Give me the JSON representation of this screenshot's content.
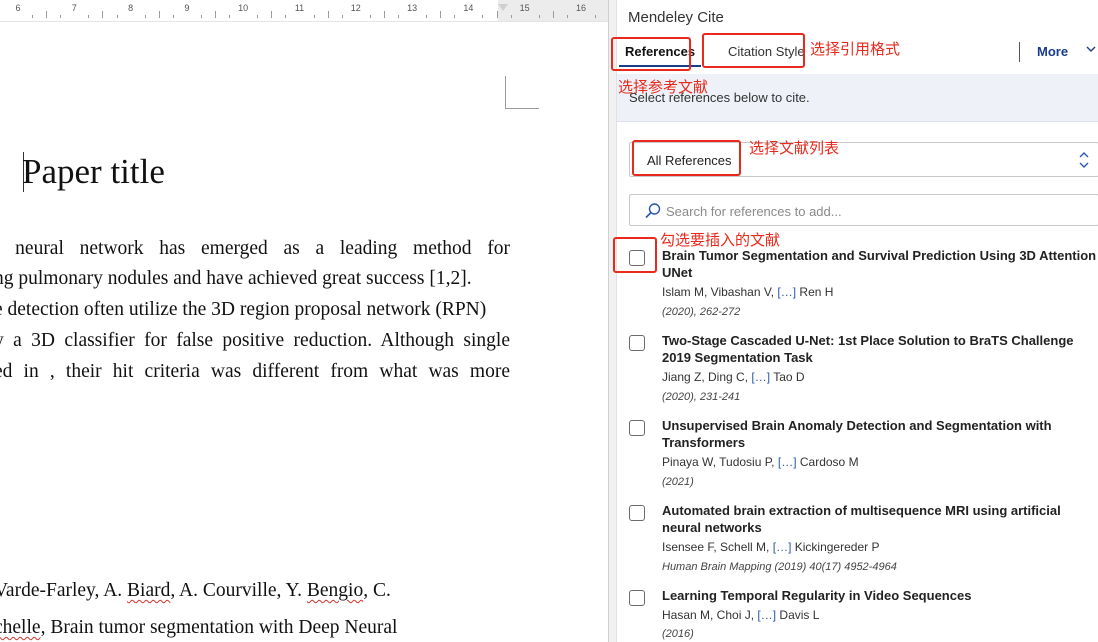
{
  "document": {
    "ruler": {
      "labels": [
        "6",
        "7",
        "8",
        "9",
        "10",
        "11",
        "12",
        "13",
        "14",
        "15",
        "16"
      ]
    },
    "title": "Paper title",
    "body_lines": [
      "l neural network has emerged as a leading method for",
      "ng pulmonary nodules and have achieved great success [1,2].",
      "e detection often utilize the 3D region proposal network (RPN)",
      "y a 3D classifier for false positive reduction. Although single",
      "ed in , their hit criteria was different from what was more"
    ],
    "reference_lines": {
      "line1": {
        "a": "Varde-Farley, A. ",
        "b": "Biard",
        "c": ", A. Courville, Y. ",
        "d": "Bengio",
        "e": ", C."
      },
      "line2": {
        "a": "chelle",
        "b": ", Brain tumor segmentation with Deep Neural"
      }
    }
  },
  "panel": {
    "title": "Mendeley Cite",
    "tabs": {
      "references": "References",
      "citation_style": "Citation Style",
      "more": "More"
    },
    "info_text": "Select references below to cite.",
    "list_select": {
      "value": "All References"
    },
    "search": {
      "placeholder": "Search for references to add..."
    },
    "references": [
      {
        "title": "Brain Tumor Segmentation and Survival Prediction Using 3D Attention UNet",
        "authors_start": "Islam M, Vibashan V,",
        "ellipsis": "[…]",
        "authors_end": "Ren H",
        "meta": "(2020), 262-272",
        "checked": false
      },
      {
        "title": "Two-Stage Cascaded U-Net: 1st Place Solution to BraTS Challenge 2019 Segmentation Task",
        "authors_start": "Jiang Z, Ding C,",
        "ellipsis": "[…]",
        "authors_end": "Tao D",
        "meta": "(2020), 231-241",
        "checked": false
      },
      {
        "title": "Unsupervised Brain Anomaly Detection and Segmentation with Transformers",
        "authors_start": "Pinaya W, Tudosiu P,",
        "ellipsis": "[…]",
        "authors_end": "Cardoso M",
        "meta": "(2021)",
        "checked": false
      },
      {
        "title": "Automated brain extraction of multisequence MRI using artificial neural networks",
        "authors_start": "Isensee F, Schell M,",
        "ellipsis": "[…]",
        "authors_end": "Kickingereder P",
        "meta": "Human Brain Mapping (2019) 40(17) 4952-4964",
        "checked": false
      },
      {
        "title": "Learning Temporal Regularity in Video Sequences",
        "authors_start": "Hasan M, Choi J,",
        "ellipsis": "[…]",
        "authors_end": "Davis L",
        "meta": "(2016)",
        "checked": false
      }
    ]
  },
  "annotations": {
    "choose_citation_style": "选择引用格式",
    "choose_references": "选择参考文献",
    "choose_reference_list": "选择文献列表",
    "check_to_insert": "勾选要插入的文献",
    "color": "#e8291c"
  },
  "colors": {
    "accent": "#1a3b8c",
    "link": "#2a57a8",
    "info_bar": "#eef2f8"
  }
}
